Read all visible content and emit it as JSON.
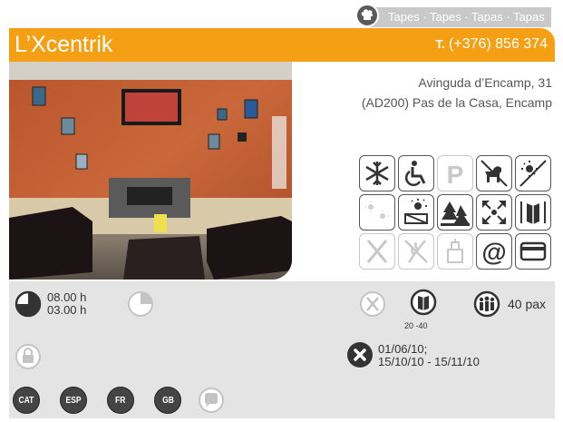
{
  "category": {
    "label": "Tapes · Tapes · Tapas · Tapas",
    "icon": "chef-hat-icon"
  },
  "header": {
    "title": "L’Xcentrik",
    "phone_prefix": "T.",
    "phone": "(+376) 856 374",
    "color": "#f5a014"
  },
  "address": {
    "line1": "Avinguda d’Encamp, 31",
    "line2": "(AD200) Pas de la Casa, Encamp"
  },
  "amenities": [
    {
      "icon": "air-conditioning-icon",
      "active": true
    },
    {
      "icon": "wheelchair-access-icon",
      "active": true
    },
    {
      "icon": "parking-icon",
      "active": false
    },
    {
      "icon": "pets-allowed-icon",
      "active": true
    },
    {
      "icon": "smoking-area-icon",
      "active": true
    },
    {
      "icon": "terrace-icon",
      "active": false
    },
    {
      "icon": "sun-terrace-icon",
      "active": true
    },
    {
      "icon": "mountain-views-icon",
      "active": true
    },
    {
      "icon": "private-room-icon",
      "active": true
    },
    {
      "icon": "menu-icon",
      "active": true
    },
    {
      "icon": "no-service-icon",
      "active": false
    },
    {
      "icon": "gluten-free-icon",
      "active": false
    },
    {
      "icon": "takeaway-icon",
      "active": false
    },
    {
      "icon": "email-icon",
      "active": true
    },
    {
      "icon": "credit-card-icon",
      "active": true
    }
  ],
  "info": {
    "hours_open": "08.00 h",
    "hours_close": "03.00 h",
    "menu_price": "20 -40",
    "capacity": "40 pax",
    "closed_dates_line1": "01/06/10;",
    "closed_dates_line2": "15/10/10 - 15/11/10"
  },
  "languages": [
    "CAT",
    "ESP",
    "FR",
    "GB"
  ]
}
